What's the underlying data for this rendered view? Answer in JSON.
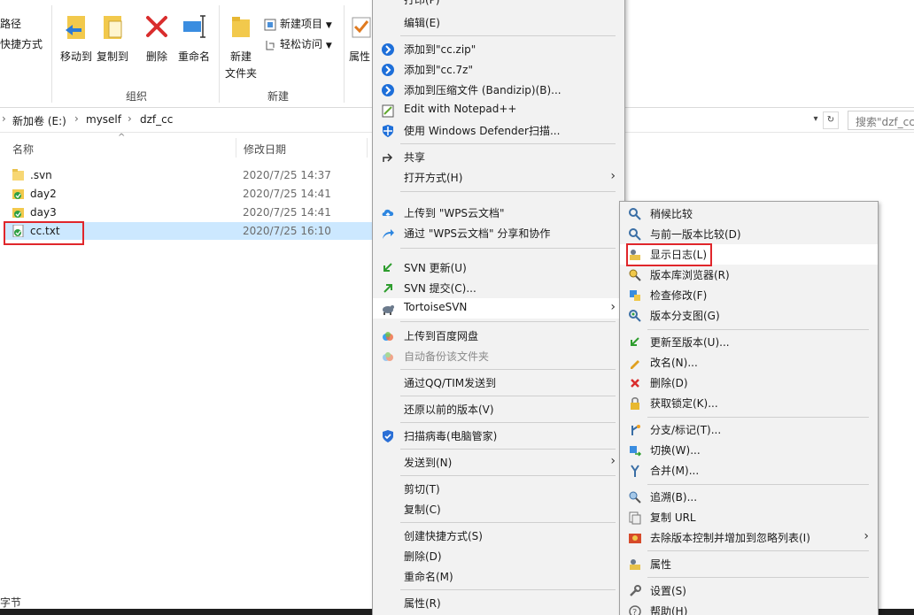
{
  "ribbon": {
    "path_partial": "路径",
    "shortcut_partial": "快捷方式",
    "move_to": "移动到",
    "copy_to": "复制到",
    "delete": "删除",
    "rename": "重命名",
    "new_folder_line1": "新建",
    "new_folder_line2": "文件夹",
    "new_item": "新建项目",
    "easy_access": "轻松访问",
    "properties": "属性",
    "group_organize": "组织",
    "group_new": "新建"
  },
  "address": {
    "crumbs": [
      "新加卷 (E:)",
      "myself",
      "dzf_cc"
    ],
    "separator": "›",
    "search_placeholder": "搜索\"dzf_cc\""
  },
  "filelist": {
    "col_name": "名称",
    "col_date": "修改日期",
    "sort_arrow": "^",
    "files": [
      {
        "name": ".svn",
        "date": "2020/7/25 14:37"
      },
      {
        "name": "day2",
        "date": "2020/7/25 14:41"
      },
      {
        "name": "day3",
        "date": "2020/7/25 14:41"
      },
      {
        "name": "cc.txt",
        "date": "2020/7/25 16:10"
      }
    ]
  },
  "status_partial": "字节",
  "context_menu": {
    "items": [
      "打印(P)",
      "编辑(E)",
      "添加到\"cc.zip\"",
      "添加到\"cc.7z\"",
      "添加到压缩文件 (Bandizip)(B)...",
      "Edit with Notepad++",
      "使用 Windows Defender扫描...",
      "共享",
      "打开方式(H)",
      "上传到 \"WPS云文档\"",
      "通过 \"WPS云文档\" 分享和协作",
      "SVN 更新(U)",
      "SVN 提交(C)...",
      "TortoiseSVN",
      "上传到百度网盘",
      "自动备份该文件夹",
      "通过QQ/TIM发送到",
      "还原以前的版本(V)",
      "扫描病毒(电脑管家)",
      "发送到(N)",
      "剪切(T)",
      "复制(C)",
      "创建快捷方式(S)",
      "删除(D)",
      "重命名(M)",
      "属性(R)"
    ],
    "submenu_arrow": "›"
  },
  "svn_menu": {
    "items": [
      "稍候比较",
      "与前一版本比较(D)",
      "显示日志(L)",
      "版本库浏览器(R)",
      "检查修改(F)",
      "版本分支图(G)",
      "更新至版本(U)...",
      "改名(N)...",
      "删除(D)",
      "获取锁定(K)...",
      "分支/标记(T)...",
      "切换(W)...",
      "合并(M)...",
      "追溯(B)...",
      "复制 URL",
      "去除版本控制并增加到忽略列表(I)",
      "属性",
      "设置(S)",
      "帮助(H)"
    ]
  },
  "colors": {
    "selection": "#cce8ff",
    "highlight_box": "#e0262b",
    "menu_bg": "#f2f2f2"
  }
}
